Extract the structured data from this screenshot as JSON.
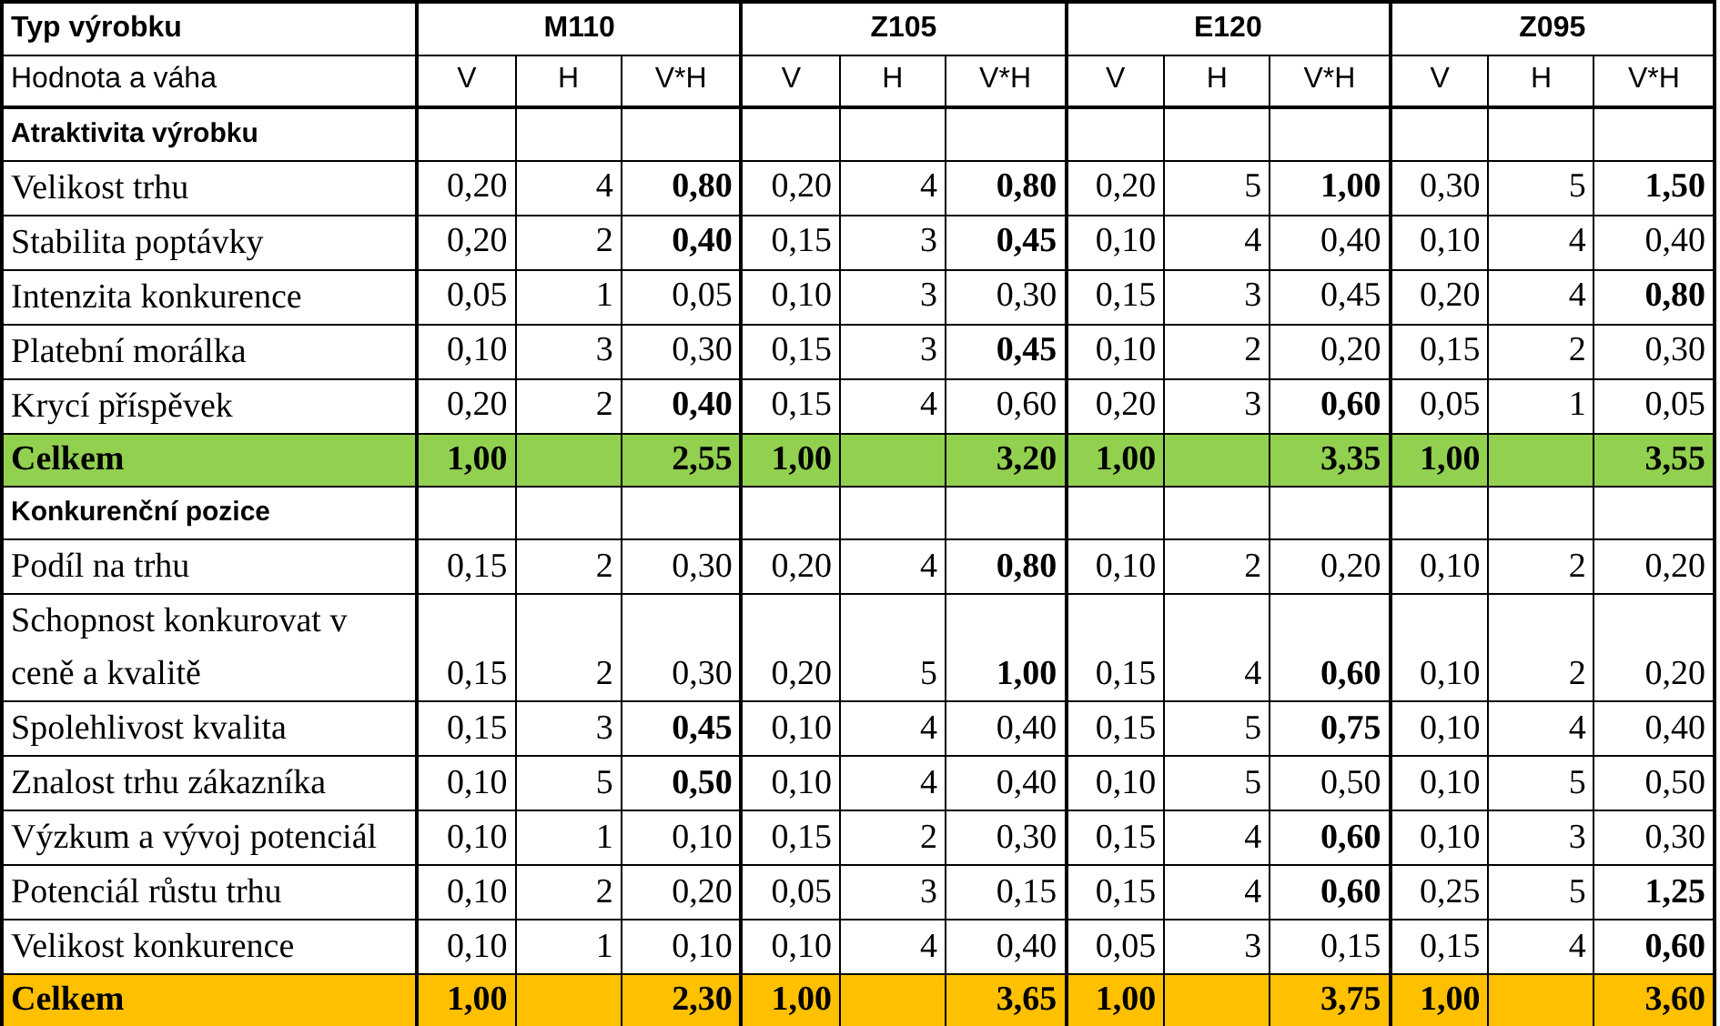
{
  "header": {
    "label": "Typ výrobku",
    "products": [
      "M110",
      "Z105",
      "E120",
      "Z095"
    ]
  },
  "subheader": {
    "label": "Hodnota a váha",
    "columns": [
      "V",
      "H",
      "V*H",
      "V",
      "H",
      "V*H",
      "V",
      "H",
      "V*H",
      "V",
      "H",
      "V*H"
    ]
  },
  "rows": [
    {
      "kind": "section",
      "label": "Atraktivita výrobku"
    },
    {
      "kind": "item",
      "label": "Velikost trhu",
      "cells": [
        {
          "v": "0,20",
          "h": "4",
          "vh": "0,80",
          "bold": true
        },
        {
          "v": "0,20",
          "h": "4",
          "vh": "0,80",
          "bold": true
        },
        {
          "v": "0,20",
          "h": "5",
          "vh": "1,00",
          "bold": true
        },
        {
          "v": "0,30",
          "h": "5",
          "vh": "1,50",
          "bold": true
        }
      ]
    },
    {
      "kind": "item",
      "label": "Stabilita poptávky",
      "cells": [
        {
          "v": "0,20",
          "h": "2",
          "vh": "0,40",
          "bold": true
        },
        {
          "v": "0,15",
          "h": "3",
          "vh": "0,45",
          "bold": true
        },
        {
          "v": "0,10",
          "h": "4",
          "vh": "0,40",
          "bold": false
        },
        {
          "v": "0,10",
          "h": "4",
          "vh": "0,40",
          "bold": false
        }
      ]
    },
    {
      "kind": "item",
      "label": "Intenzita konkurence",
      "cells": [
        {
          "v": "0,05",
          "h": "1",
          "vh": "0,05",
          "bold": false
        },
        {
          "v": "0,10",
          "h": "3",
          "vh": "0,30",
          "bold": false
        },
        {
          "v": "0,15",
          "h": "3",
          "vh": "0,45",
          "bold": false
        },
        {
          "v": "0,20",
          "h": "4",
          "vh": "0,80",
          "bold": true
        }
      ]
    },
    {
      "kind": "item",
      "label": "Platební morálka",
      "cells": [
        {
          "v": "0,10",
          "h": "3",
          "vh": "0,30",
          "bold": false
        },
        {
          "v": "0,15",
          "h": "3",
          "vh": "0,45",
          "bold": true
        },
        {
          "v": "0,10",
          "h": "2",
          "vh": "0,20",
          "bold": false
        },
        {
          "v": "0,15",
          "h": "2",
          "vh": "0,30",
          "bold": false
        }
      ]
    },
    {
      "kind": "item",
      "label": "Krycí příspěvek",
      "cells": [
        {
          "v": "0,20",
          "h": "2",
          "vh": "0,40",
          "bold": true
        },
        {
          "v": "0,15",
          "h": "4",
          "vh": "0,60",
          "bold": false
        },
        {
          "v": "0,20",
          "h": "3",
          "vh": "0,60",
          "bold": true
        },
        {
          "v": "0,05",
          "h": "1",
          "vh": "0,05",
          "bold": false
        }
      ]
    },
    {
      "kind": "total",
      "label": "Celkem",
      "color": "#92d050",
      "cells": [
        {
          "v": "1,00",
          "vh": "2,55"
        },
        {
          "v": "1,00",
          "vh": "3,20"
        },
        {
          "v": "1,00",
          "vh": "3,35"
        },
        {
          "v": "1,00",
          "vh": "3,55"
        }
      ]
    },
    {
      "kind": "section",
      "label": "Konkurenční pozice"
    },
    {
      "kind": "item",
      "label": "Podíl na trhu",
      "cells": [
        {
          "v": "0,15",
          "h": "2",
          "vh": "0,30",
          "bold": false
        },
        {
          "v": "0,20",
          "h": "4",
          "vh": "0,80",
          "bold": true
        },
        {
          "v": "0,10",
          "h": "2",
          "vh": "0,20",
          "bold": false
        },
        {
          "v": "0,10",
          "h": "2",
          "vh": "0,20",
          "bold": false
        }
      ]
    },
    {
      "kind": "item",
      "label": "Schopnost konkurovat v ceně a kvalitě",
      "cells": [
        {
          "v": "0,15",
          "h": "2",
          "vh": "0,30",
          "bold": false
        },
        {
          "v": "0,20",
          "h": "5",
          "vh": "1,00",
          "bold": true
        },
        {
          "v": "0,15",
          "h": "4",
          "vh": "0,60",
          "bold": true
        },
        {
          "v": "0,10",
          "h": "2",
          "vh": "0,20",
          "bold": false
        }
      ]
    },
    {
      "kind": "item",
      "label": "Spolehlivost kvalita",
      "cells": [
        {
          "v": "0,15",
          "h": "3",
          "vh": "0,45",
          "bold": true
        },
        {
          "v": "0,10",
          "h": "4",
          "vh": "0,40",
          "bold": false
        },
        {
          "v": "0,15",
          "h": "5",
          "vh": "0,75",
          "bold": true
        },
        {
          "v": "0,10",
          "h": "4",
          "vh": "0,40",
          "bold": false
        }
      ]
    },
    {
      "kind": "item",
      "label": "Znalost trhu zákazníka",
      "cells": [
        {
          "v": "0,10",
          "h": "5",
          "vh": "0,50",
          "bold": true
        },
        {
          "v": "0,10",
          "h": "4",
          "vh": "0,40",
          "bold": false
        },
        {
          "v": "0,10",
          "h": "5",
          "vh": "0,50",
          "bold": false
        },
        {
          "v": "0,10",
          "h": "5",
          "vh": "0,50",
          "bold": false
        }
      ]
    },
    {
      "kind": "item",
      "label": "Výzkum a vývoj potenciál",
      "cells": [
        {
          "v": "0,10",
          "h": "1",
          "vh": "0,10",
          "bold": false
        },
        {
          "v": "0,15",
          "h": "2",
          "vh": "0,30",
          "bold": false
        },
        {
          "v": "0,15",
          "h": "4",
          "vh": "0,60",
          "bold": true
        },
        {
          "v": "0,10",
          "h": "3",
          "vh": "0,30",
          "bold": false
        }
      ]
    },
    {
      "kind": "item",
      "label": "Potenciál růstu trhu",
      "cells": [
        {
          "v": "0,10",
          "h": "2",
          "vh": "0,20",
          "bold": false
        },
        {
          "v": "0,05",
          "h": "3",
          "vh": "0,15",
          "bold": false
        },
        {
          "v": "0,15",
          "h": "4",
          "vh": "0,60",
          "bold": true
        },
        {
          "v": "0,25",
          "h": "5",
          "vh": "1,25",
          "bold": true
        }
      ]
    },
    {
      "kind": "item",
      "label": "Velikost konkurence",
      "cells": [
        {
          "v": "0,10",
          "h": "1",
          "vh": "0,10",
          "bold": false
        },
        {
          "v": "0,10",
          "h": "4",
          "vh": "0,40",
          "bold": false
        },
        {
          "v": "0,05",
          "h": "3",
          "vh": "0,15",
          "bold": false
        },
        {
          "v": "0,15",
          "h": "4",
          "vh": "0,60",
          "bold": true
        }
      ]
    },
    {
      "kind": "total",
      "label": "Celkem",
      "color": "#ffc000",
      "cells": [
        {
          "v": "1,00",
          "vh": "2,30"
        },
        {
          "v": "1,00",
          "vh": "3,65"
        },
        {
          "v": "1,00",
          "vh": "3,75"
        },
        {
          "v": "1,00",
          "vh": "3,60"
        }
      ]
    }
  ]
}
